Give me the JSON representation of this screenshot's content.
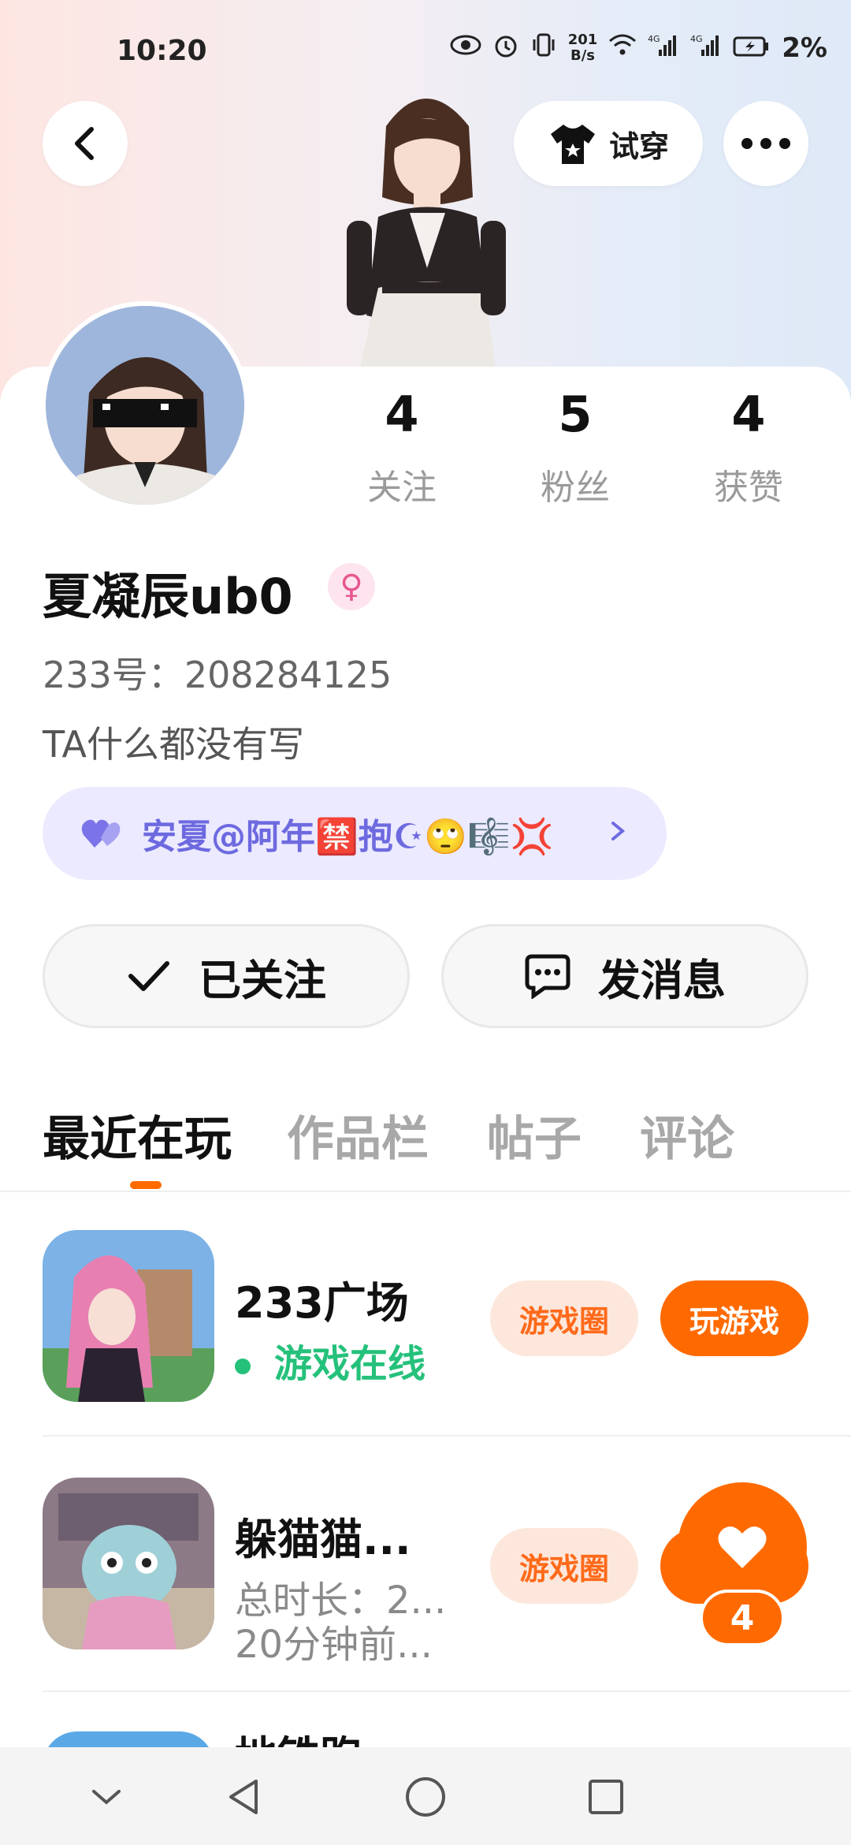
{
  "status_bar": {
    "time": "10:20",
    "net_speed_value": "201",
    "net_speed_unit": "B/s",
    "signal_1": "4G",
    "signal_2": "4G",
    "battery": "2%"
  },
  "header": {
    "try_on_label": "试穿"
  },
  "stats": [
    {
      "count": "4",
      "label": "关注"
    },
    {
      "count": "5",
      "label": "粉丝"
    },
    {
      "count": "4",
      "label": "获赞"
    }
  ],
  "profile": {
    "username": "夏凝辰ub0",
    "gender_symbol": "♀",
    "uid_label": "233号：",
    "uid_value": "208284125",
    "bio": "TA什么都没有写"
  },
  "cp": {
    "text": "安夏@阿年🈲抱☪🙄🎼💢"
  },
  "actions": {
    "follow_label": "已关注",
    "message_label": "发消息"
  },
  "tabs": [
    {
      "label": "最近在玩",
      "active": true
    },
    {
      "label": "作品栏",
      "active": false
    },
    {
      "label": "帖子",
      "active": false
    },
    {
      "label": "评论",
      "active": false
    }
  ],
  "games": [
    {
      "name": "233广场",
      "status": "游戏在线",
      "circle_label": "游戏圈",
      "play_label": "玩游戏"
    },
    {
      "name": "躲猫猫...",
      "duration": "总时长：2...",
      "last_played": "20分钟前...",
      "circle_label": "游戏圈"
    },
    {
      "name": "地铁跑"
    }
  ],
  "like_float": {
    "count": "4"
  },
  "colors": {
    "accent": "#ff6a00",
    "online": "#25c17b",
    "cp_text": "#6d6ae0"
  }
}
